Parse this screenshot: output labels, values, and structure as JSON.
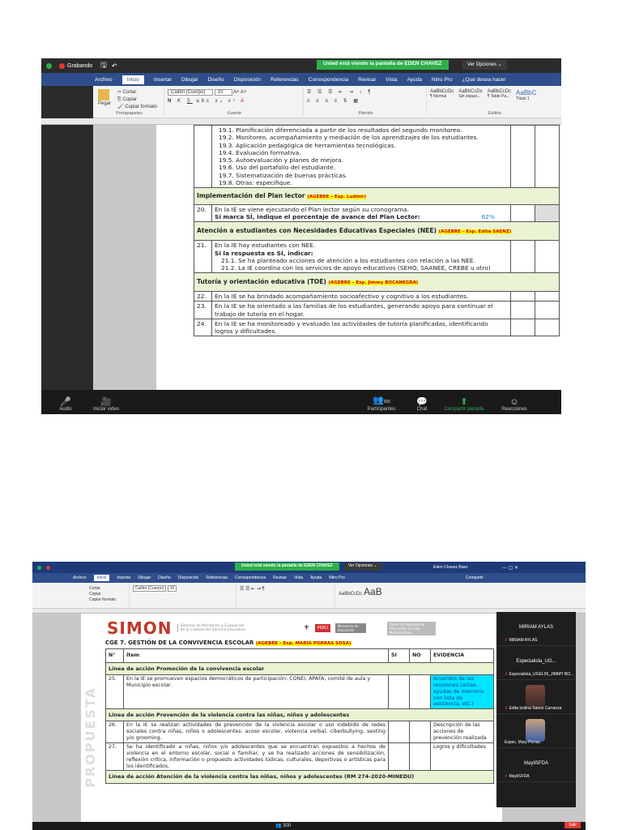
{
  "shot1": {
    "recording_label": "Grabando",
    "banner": "Usted está viendo la pantalla de EDEN CHAVEZ",
    "view_options": "Ver Opciones",
    "menu": [
      "Archivo",
      "Inicio",
      "Insertar",
      "Dibujar",
      "Diseño",
      "Disposición",
      "Referencias",
      "Correspondencia",
      "Revisar",
      "Vista",
      "Ayuda",
      "Nitro Pro",
      "¿Qué desea hacer"
    ],
    "ribbon": {
      "paste": "Pegar",
      "cut": "Cortar",
      "copy": "Copiar",
      "copy_format": "Copiar formato",
      "clipboard": "Portapapeles",
      "font_name": "Calibri (Cuerpo)",
      "font_size": "10",
      "font_group": "Fuente",
      "paragraph": "Párrafo",
      "styles": "Estilos",
      "style_names": [
        "¶ Normal",
        "Sin espaci...",
        "¶ Table Pa...",
        "Título 1"
      ],
      "style_sample": "AaBbCcDc"
    },
    "rows_top": [
      "19.1.   Planificación diferenciada a partir de los resultados del segundo monitoreo.",
      "19.2.   Monitoreo, acompañamiento y mediación de los aprendizajes de los estudiantes.",
      "19.3.   Aplicación pedagógica de herramientas tecnológicas.",
      "19.4.   Evaluación formativa.",
      "19.5.   Autoevaluación y planes de mejora.",
      "19.6.   Uso del portafolio del estudiante.",
      "19.7.   Sistematización de buenas prácticas.",
      "19.8.   Otras: especifique."
    ],
    "sec_lector": "Implementación del Plan lector",
    "tag_lector": "(AGEBRE – Esp. Ludmir)",
    "row20_num": "20.",
    "row20_a": "En la IE se viene ejecutando el Plan lector según su cronograma.",
    "row20_b": "Si marca SÍ, indique el porcentaje de avance del Plan Lector:",
    "row20_pct": "62%",
    "sec_nee": "Atención a estudiantes con Necesidades Educativas Especiales (NEE)",
    "tag_nee": "(AGEBRE – Esp. Edita SAENZ)",
    "row21_num": "21.",
    "row21_a": "En la IE hay estudiantes con NEE.",
    "row21_b": "Si la respuesta es SÍ, indicar:",
    "row21_1": "21.1.   Se ha planteado acciones de atención a los estudiantes con relación a las NEE.",
    "row21_2": "21.2.   La IE coordina con los servicios de apoyo educativos (SEHO, SAANEE, CREBE u otro)",
    "sec_toe": "Tutoría y orientación educativa (TOE)",
    "tag_toe": "(AGEBRE – Esp. Jimmy BOCANEGRA)",
    "row22_num": "22.",
    "row22": "En la IE se ha brindado acompañamiento socioafectivo y cognitivo a los estudiantes.",
    "row23_num": "23.",
    "row23": "En la IE se ha orientado a las familias de los estudiantes, generando apoyo para continuar el trabajo de tutoría en el hogar.",
    "row24_num": "24.",
    "row24": "En la IE se ha monitoreado y evaluado las actividades de tutoría planificadas, identificando logros y dificultades.",
    "bottom": {
      "audio": "Audio",
      "video": "Iniciar video",
      "participants": "Participantes",
      "count": "300",
      "chat": "Chat",
      "share": "Compartir pantalla",
      "reactions": "Reacciones"
    }
  },
  "shot2": {
    "banner": "Usted está viendo la pantalla de EDEN CHAVEZ",
    "view_options": "Ver Opciones",
    "user": "Eden Chavez Baez",
    "share_btn": "Compartir",
    "header_logo": "SIMON",
    "header_sub": "Sistema de Monitoreo y Evaluación de la Calidad del Servicio Educativo",
    "peru": "PERÚ",
    "ministry": "Ministerio de Educación",
    "region": "Dirección Regional de Educación de Lima Metropolitana",
    "title": "CGE 7.  GESTIÓN DE LA CONVIVENCIA ESCOLAR",
    "title_tag": "(AGEBRE – Esp. MARIA PORRAS SOSA)",
    "cols": [
      "N°",
      "Ítem",
      "SI",
      "NO",
      "EVIDENCIA"
    ],
    "sec1": "Línea de acción Promoción de la convivencia escolar",
    "r25_num": "25.",
    "r25": "En la IE se promueven espacios democráticos de participación: CONEI, APAFA, comité de aula y Municipio escolar.",
    "r25_ev": "Acuerdos de las reuniones (actas, ayudas de memoria con lista de asistencia, etc.)",
    "sec2": "Línea de acción Prevención de la violencia contra las niñas, niños y adolescentes",
    "r26_num": "26.",
    "r26": "En la IE se realizan actividades de prevención de la violencia escolar o uso indebido de redes sociales contra niñas, niños o adolescentes: acoso escolar, violencia verbal, ciberbullying, sexting y/o grooming.",
    "r26_ev": "Descripción de las acciones de prevención realizada",
    "r27_num": "27.",
    "r27": "Se ha identificado a niñas, niños y/o adolescentes que se encuentran expuestos a hechos de violencia en el entorno escolar, social o familiar, y se ha realizado acciones de sensibilización, reflexión crítica, información o propuesto actividades lúdicas, culturales, deportivas o artísticas para los identificados.",
    "r27_ev": "Logros y dificultades",
    "sec3": "Línea de acción Atención de la violencia contra las niñas, niños y adolescentes (RM 274-2020-MINEDU)",
    "watermark": "PROPUESTA",
    "participants": [
      {
        "big": "MIRIAM AYLAS",
        "small": "MIRIAM AYLAS"
      },
      {
        "big": "Especialista_UG...",
        "small": "Especialista_UGEL06_JIMMY BO..."
      },
      {
        "big": "",
        "small": "Edita Izolina Saenz Carranza"
      },
      {
        "big": "",
        "small": "Espec. Mary Porras"
      },
      {
        "big": "MayliSFDA",
        "small": "MayliSFDA"
      }
    ],
    "leave": "Salir",
    "count": "300"
  }
}
